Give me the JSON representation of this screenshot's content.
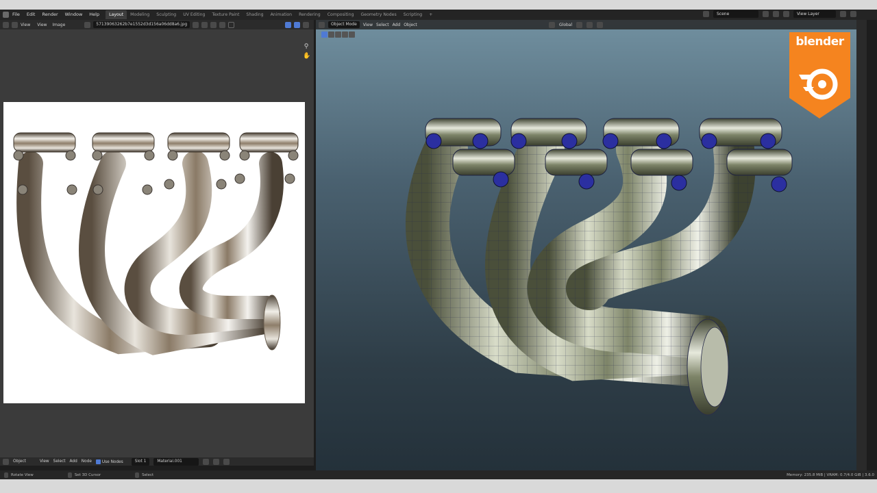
{
  "topbar": {
    "menu": [
      "File",
      "Edit",
      "Render",
      "Window",
      "Help"
    ],
    "tabs": [
      "Layout",
      "Modeling",
      "Sculpting",
      "UV Editing",
      "Texture Paint",
      "Shading",
      "Animation",
      "Rendering",
      "Compositing",
      "Geometry Nodes",
      "Scripting"
    ],
    "active_tab": "Layout",
    "add_tab": "+",
    "scene": "Scene",
    "view_layer": "View Layer"
  },
  "image_editor": {
    "header": [
      "View",
      "View",
      "Image"
    ],
    "image_name": "57139063262b7e1552d3d156a06dd8a6.jpg",
    "footer": {
      "editor": "Object",
      "items": [
        "View",
        "Select",
        "Add",
        "Node"
      ],
      "use_nodes": "Use Nodes",
      "slot": "Slot 1",
      "material": "Material.001"
    }
  },
  "viewport": {
    "mode": "Object Mode",
    "menus": [
      "View",
      "Select",
      "Add",
      "Object"
    ],
    "transform": "Global"
  },
  "statusbar": {
    "rotate": "Rotate View",
    "cursor": "Set 3D Cursor",
    "select": "Select",
    "memory": "Memory: 235.8 MiB | VRAM: 0.7/4.0 GiB | 3.6.0"
  },
  "logo": {
    "text": "blender"
  },
  "colors": {
    "accent": "#4f7ad4",
    "logo_orange": "#f5841f",
    "bolt_blue": "#2b2fa0"
  }
}
